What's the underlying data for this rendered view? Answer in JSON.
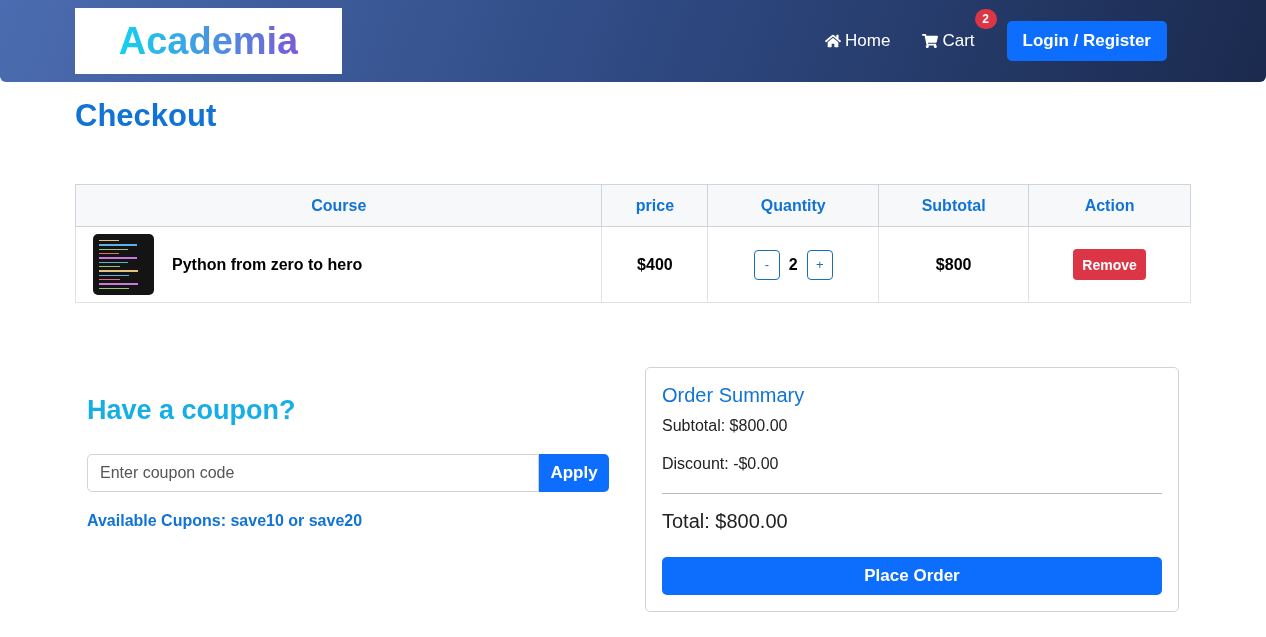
{
  "header": {
    "logo": "Academia",
    "nav": [
      {
        "kind": "home",
        "label": "Home"
      },
      {
        "kind": "cart",
        "label": "Cart",
        "badge": "2"
      }
    ],
    "login": "Login / Register"
  },
  "title": "Checkout",
  "table": {
    "columns": [
      "Course",
      "price",
      "Quantity",
      "Subtotal",
      "Action"
    ],
    "rows": [
      {
        "course": "Python from zero to hero",
        "price": "$400",
        "minus": "-",
        "quantity": "2",
        "plus": "+",
        "subtotal": "$800",
        "action": "Remove"
      }
    ]
  },
  "coupon": {
    "heading": "Have a coupon?",
    "placeholder": "Enter coupon code",
    "button": "Apply",
    "hint": "Available Cupons: save10 or save20"
  },
  "summary": {
    "title": "Order Summary",
    "subtotal": "Subtotal: $800.00",
    "discount": "Discount: -$0.00",
    "total": "Total: $800.00",
    "button": "Place Order"
  }
}
